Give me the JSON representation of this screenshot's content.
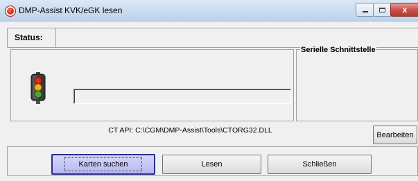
{
  "window": {
    "title": "DMP-Assist KVK/eGK lesen",
    "close_glyph": "x"
  },
  "status": {
    "label": "Status:",
    "value": ""
  },
  "serial": {
    "title": "Serielle Schnittstelle"
  },
  "ct_api": {
    "text": "CT API: C:\\CGM\\DMP-Assist\\Tools\\CTORG32.DLL"
  },
  "buttons": {
    "edit": "Bearbeiten",
    "search_cards": "Karten suchen",
    "read": "Lesen",
    "close": "Schließen"
  },
  "icons": {
    "app": "app-logo-icon",
    "traffic": "traffic-light-icon"
  },
  "colors": {
    "focus_button": "#b8b8f2",
    "titlebar": "#c9dbef",
    "close_button": "#c75050"
  }
}
